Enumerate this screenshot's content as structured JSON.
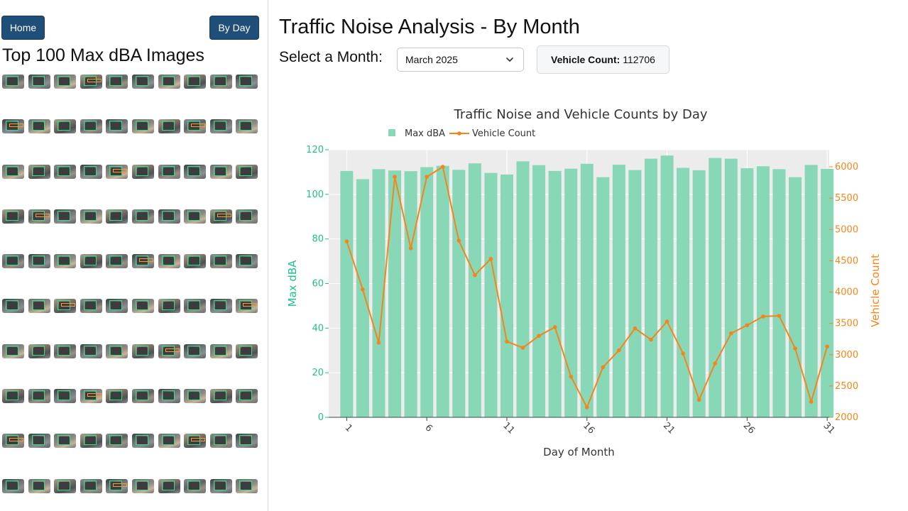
{
  "sidebar": {
    "home_label": "Home",
    "by_day_label": "By Day",
    "title": "Top 100 Max dBA Images",
    "image_rows": 10,
    "images_per_row": 10
  },
  "header": {
    "title": "Traffic Noise Analysis - By Month",
    "select_label": "Select a Month:",
    "month_selected": "March 2025",
    "vehicle_count_label": "Vehicle Count:",
    "vehicle_count_value": "112706"
  },
  "colors": {
    "bar": "#88d8b8",
    "line": "#f58518",
    "left_axis": "#1fbf8f",
    "right_axis": "#f58518",
    "button": "#1f4e79",
    "plot_bg": "#ececec"
  },
  "chart_data": {
    "type": "bar+line",
    "title": "Traffic Noise and Vehicle Counts by Day",
    "xlabel": "Day of Month",
    "ylabel_left": "Max dBA",
    "ylabel_right": "Vehicle Count",
    "legend": [
      "Max dBA",
      "Vehicle Count"
    ],
    "legend_placement": "top-left",
    "grid": true,
    "x": [
      1,
      2,
      3,
      4,
      5,
      6,
      7,
      8,
      9,
      10,
      11,
      12,
      13,
      14,
      15,
      16,
      17,
      18,
      19,
      20,
      21,
      22,
      23,
      24,
      25,
      26,
      27,
      28,
      29,
      30,
      31
    ],
    "x_ticks": [
      1,
      6,
      11,
      16,
      21,
      26,
      31
    ],
    "ylim_left": [
      0,
      120
    ],
    "yticks_left": [
      0,
      20,
      40,
      60,
      80,
      100,
      120
    ],
    "ylim_right": [
      2000,
      6000
    ],
    "yticks_right": [
      2000,
      2500,
      3000,
      3500,
      4000,
      4500,
      5000,
      5500,
      6000
    ],
    "series": [
      {
        "name": "Max dBA",
        "kind": "bar",
        "axis": "left",
        "values": [
          110.5,
          106.8,
          111.3,
          110.7,
          110.4,
          112.2,
          112.8,
          111.0,
          113.9,
          109.6,
          108.9,
          114.8,
          113.1,
          110.5,
          111.5,
          113.7,
          107.7,
          113.3,
          110.9,
          116.0,
          117.4,
          111.9,
          110.8,
          116.3,
          116.0,
          111.7,
          112.6,
          111.3,
          107.7,
          113.2,
          111.4
        ]
      },
      {
        "name": "Vehicle Count",
        "kind": "line",
        "axis": "right",
        "values": [
          4810,
          4040,
          3190,
          5840,
          4700,
          5840,
          6000,
          4820,
          4270,
          4530,
          3210,
          3110,
          3300,
          3440,
          2650,
          2160,
          2800,
          3070,
          3420,
          3240,
          3530,
          3020,
          2280,
          2860,
          3340,
          3470,
          3610,
          3620,
          3100,
          2250,
          3130
        ]
      }
    ]
  }
}
